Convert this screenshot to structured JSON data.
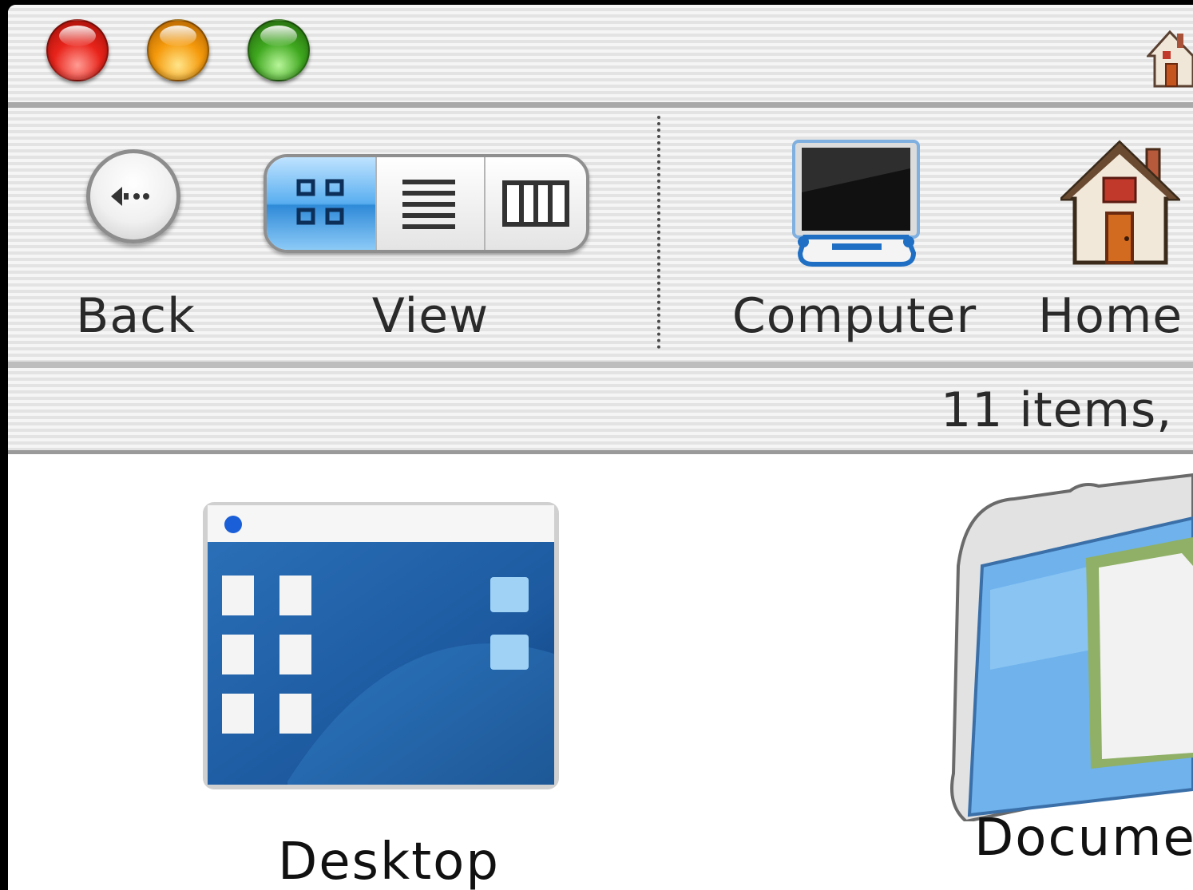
{
  "window": {
    "title_icon": "home-icon"
  },
  "titlebar": {
    "buttons": [
      "close",
      "minimize",
      "zoom"
    ]
  },
  "toolbar": {
    "back_label": "Back",
    "view_label": "View",
    "view_modes": [
      "icon-view",
      "list-view",
      "column-view"
    ],
    "selected_view": "icon-view",
    "computer_label": "Computer",
    "home_label": "Home"
  },
  "status": {
    "text": "11 items, "
  },
  "files": [
    {
      "name": "Desktop",
      "icon": "desktop-folder-icon"
    },
    {
      "name": "Documer",
      "icon": "documents-folder-icon"
    }
  ],
  "colors": {
    "selected_segment": "#58aef0",
    "close": "#e8241b",
    "minimize": "#f59a0c",
    "zoom": "#3fa81f"
  }
}
